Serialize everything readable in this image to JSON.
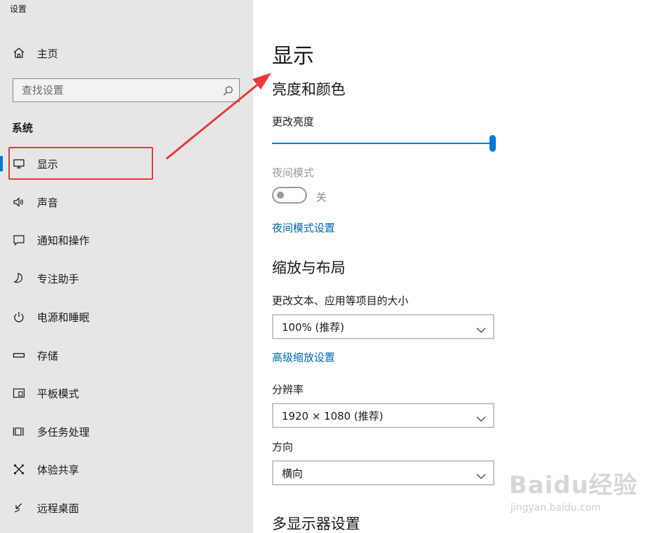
{
  "window": {
    "title": "设置"
  },
  "sidebar": {
    "home_label": "主页",
    "search_placeholder": "查找设置",
    "group_label": "系统",
    "items": [
      {
        "label": "显示",
        "icon": "monitor-icon",
        "selected": true
      },
      {
        "label": "声音",
        "icon": "speaker-icon"
      },
      {
        "label": "通知和操作",
        "icon": "notification-icon"
      },
      {
        "label": "专注助手",
        "icon": "moon-icon"
      },
      {
        "label": "电源和睡眠",
        "icon": "power-icon"
      },
      {
        "label": "存储",
        "icon": "storage-icon"
      },
      {
        "label": "平板模式",
        "icon": "tablet-icon"
      },
      {
        "label": "多任务处理",
        "icon": "multitask-icon"
      },
      {
        "label": "体验共享",
        "icon": "share-icon"
      },
      {
        "label": "远程桌面",
        "icon": "remote-desktop-icon"
      }
    ]
  },
  "main": {
    "title": "显示",
    "brightness": {
      "heading": "亮度和颜色",
      "label": "更改亮度",
      "value_percent": 100
    },
    "night_light": {
      "label": "夜间模式",
      "state": "关",
      "settings_link": "夜间模式设置"
    },
    "scale": {
      "heading": "缩放与布局",
      "label": "更改文本、应用等项目的大小",
      "value": "100% (推荐)",
      "advanced_link": "高级缩放设置"
    },
    "resolution": {
      "label": "分辨率",
      "value": "1920 × 1080 (推荐)"
    },
    "orientation": {
      "label": "方向",
      "value": "横向"
    },
    "multi_display": {
      "heading": "多显示器设置"
    }
  },
  "colors": {
    "accent": "#0078d7",
    "annotation": "#e8393a",
    "link": "#0063b1"
  },
  "watermark": {
    "brand": "Baidu经验",
    "url": "jingyan.baidu.com"
  }
}
